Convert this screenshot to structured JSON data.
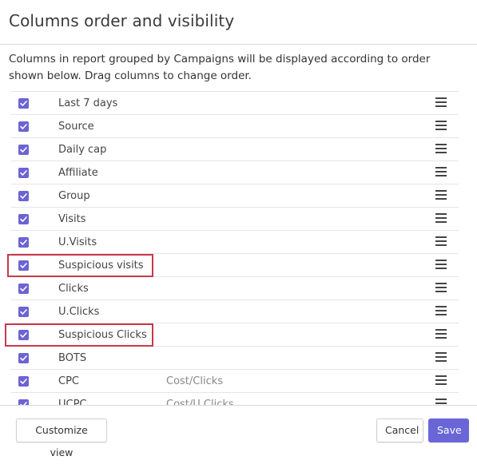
{
  "dialog": {
    "title": "Columns order and visibility",
    "description": "Columns in report grouped by Campaigns will be displayed according to order shown below. Drag columns to change order."
  },
  "columns": [
    {
      "name": "Last 7 days",
      "formula": "",
      "checked": true,
      "highlighted": false
    },
    {
      "name": "Source",
      "formula": "",
      "checked": true,
      "highlighted": false
    },
    {
      "name": "Daily cap",
      "formula": "",
      "checked": true,
      "highlighted": false
    },
    {
      "name": "Affiliate",
      "formula": "",
      "checked": true,
      "highlighted": false
    },
    {
      "name": "Group",
      "formula": "",
      "checked": true,
      "highlighted": false
    },
    {
      "name": "Visits",
      "formula": "",
      "checked": true,
      "highlighted": false
    },
    {
      "name": "U.Visits",
      "formula": "",
      "checked": true,
      "highlighted": false
    },
    {
      "name": "Suspicious visits",
      "formula": "",
      "checked": true,
      "highlighted": true
    },
    {
      "name": "Clicks",
      "formula": "",
      "checked": true,
      "highlighted": false
    },
    {
      "name": "U.Clicks",
      "formula": "",
      "checked": true,
      "highlighted": false
    },
    {
      "name": "Suspicious Clicks",
      "formula": "",
      "checked": true,
      "highlighted": true
    },
    {
      "name": "BOTS",
      "formula": "",
      "checked": true,
      "highlighted": false
    },
    {
      "name": "CPC",
      "formula": "Cost/Clicks",
      "checked": true,
      "highlighted": false
    },
    {
      "name": "UCPC",
      "formula": "Cost/U.Clicks",
      "checked": true,
      "highlighted": false
    }
  ],
  "footer": {
    "customize_label": "Customize view",
    "cancel_label": "Cancel",
    "save_label": "Save"
  },
  "colors": {
    "accent": "#6a66d8",
    "checkbox": "#6c63d4",
    "highlight": "#c63a4c"
  }
}
